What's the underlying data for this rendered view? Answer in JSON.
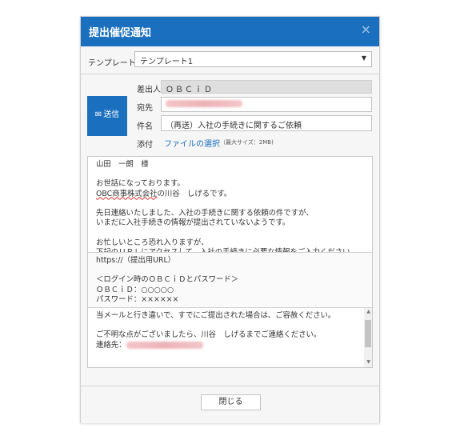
{
  "dialog": {
    "title": "提出催促通知",
    "close_icon": "×"
  },
  "template": {
    "label": "テンプレート",
    "selected": "テンプレート1"
  },
  "send_button": {
    "label": "送信",
    "icon": "envelope-icon"
  },
  "fields": {
    "sender_label": "差出人",
    "sender_value": "ＯＢＣｉＤ",
    "to_label": "宛先",
    "subject_label": "件名",
    "subject_value": "（再送）入社の手続きに関するご依頼",
    "attach_label": "添付",
    "attach_link": "ファイルの選択",
    "attach_note": "（最大サイズ：2MB)"
  },
  "body": {
    "section1_line1": "山田　一朗　様",
    "section1_line2": "お世話になっております。",
    "section1_line3_company": "OBC商事株式会社",
    "section1_line3_rest": "の川谷　しげるです。",
    "section1_line4": "先日連絡いたしました、入社の手続きに関する依頼の件ですが、",
    "section1_line5": "いまだに入社手続きの情報が提出されていないようです。",
    "section1_line6": "お忙しいところ恐れ入りますが、",
    "section1_line7": "下記のＵＲＬにアクセスして、入社の手続きに必要な情報をご入力ください。",
    "section2_line1": "https://（提出用URL）",
    "section2_line2": "＜ログイン時のＯＢＣｉＤとパスワード＞",
    "section2_line3": "ＯＢＣｉＤ：○○○○○",
    "section2_line4": "パスワード：××××××",
    "section3_line1": "当メールと行き違いで、すでにご提出された場合は、ご容赦ください。",
    "section3_line2": "ご不明な点がございましたら、川谷　しげるまでご連絡ください。",
    "section3_line3": "連絡先："
  },
  "footer": {
    "close_label": "閉じる"
  }
}
